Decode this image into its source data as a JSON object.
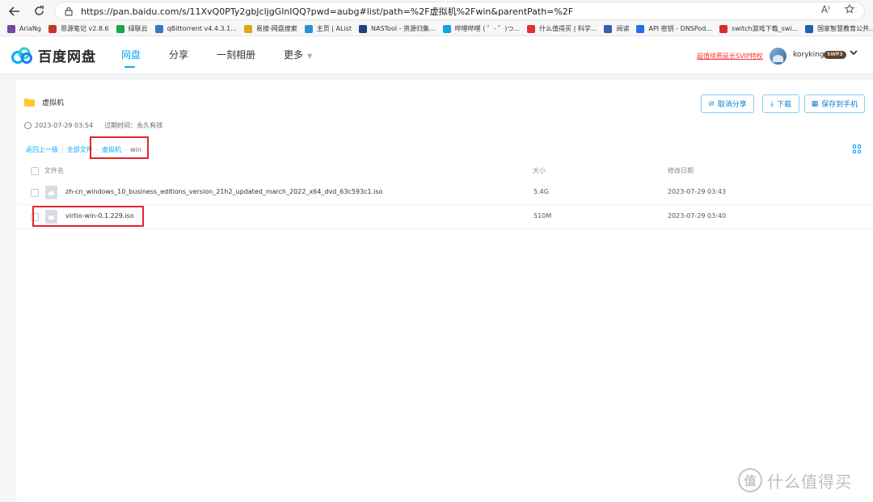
{
  "browser": {
    "url": "https://pan.baidu.com/s/11XvQ0PTy2gbJcljgGlnIQQ?pwd=aubg#list/path=%2F虚拟机%2Fwin&parentPath=%2F",
    "reader_icon": "A⁾",
    "bookmarks": [
      {
        "label": "AriaNg",
        "icon": "ariang-icon",
        "color": "#6d4aa8"
      },
      {
        "label": "思源笔记 v2.8.6",
        "icon": "siyuan-icon",
        "color": "#c0392b"
      },
      {
        "label": "绿联云",
        "icon": "ugreen-icon",
        "color": "#1aa84f"
      },
      {
        "label": "qBittorrent v4.4.3.1...",
        "icon": "qbittorrent-icon",
        "color": "#3578c6"
      },
      {
        "label": "易搜-网盘搜索",
        "icon": "yisou-icon",
        "color": "#e3a51b"
      },
      {
        "label": "主页 | AList",
        "icon": "alist-icon",
        "color": "#2c8fd0"
      },
      {
        "label": "NASTool - 资源归集...",
        "icon": "nastool-icon",
        "color": "#22407a"
      },
      {
        "label": "哔哩哔哩 ( ゜- ゜)つ...",
        "icon": "bilibili-icon",
        "color": "#19a3e0"
      },
      {
        "label": "什么值得买 | 科学...",
        "icon": "smzdm-icon",
        "color": "#e03030"
      },
      {
        "label": "阅读",
        "icon": "read-icon",
        "color": "#3d5ab8"
      },
      {
        "label": "API 密钥 - DNSPod...",
        "icon": "dnspod-icon",
        "color": "#1a73e8"
      },
      {
        "label": "switch游戏下载_swi...",
        "icon": "switch-icon",
        "color": "#d32f2f"
      },
      {
        "label": "国家智慧教育公共...",
        "icon": "edu-icon",
        "color": "#2060b0"
      }
    ]
  },
  "header": {
    "logo_text": "百度网盘",
    "nav": [
      {
        "label": "网盘",
        "active": true
      },
      {
        "label": "分享",
        "active": false
      },
      {
        "label": "一刻相册",
        "active": false
      },
      {
        "label": "更多",
        "active": false
      }
    ],
    "promo": "超值续费延长SVIP特权",
    "username": "koryking",
    "vip_badge": "SWP3"
  },
  "share": {
    "title": "虚拟机",
    "time": "2023-07-29 03:54",
    "expire_label": "过期时间：永久有效",
    "buttons": {
      "cancel": "取消分享",
      "download": "下载",
      "save": "保存到手机"
    }
  },
  "breadcrumb": {
    "back": "返回上一级",
    "all": "全部文件",
    "folder": "虚拟机",
    "current": "win"
  },
  "table": {
    "columns": {
      "name": "文件名",
      "size": "大小",
      "date": "修改日期"
    },
    "rows": [
      {
        "name": "zh-cn_windows_10_business_editions_version_21h2_updated_march_2022_x64_dvd_63c593c1.iso",
        "size": "5.4G",
        "date": "2023-07-29 03:43"
      },
      {
        "name": "virtio-win-0.1.229.iso",
        "size": "510M",
        "date": "2023-07-29 03:40"
      }
    ]
  },
  "watermark": {
    "mark": "值",
    "text": "什么值得买"
  }
}
